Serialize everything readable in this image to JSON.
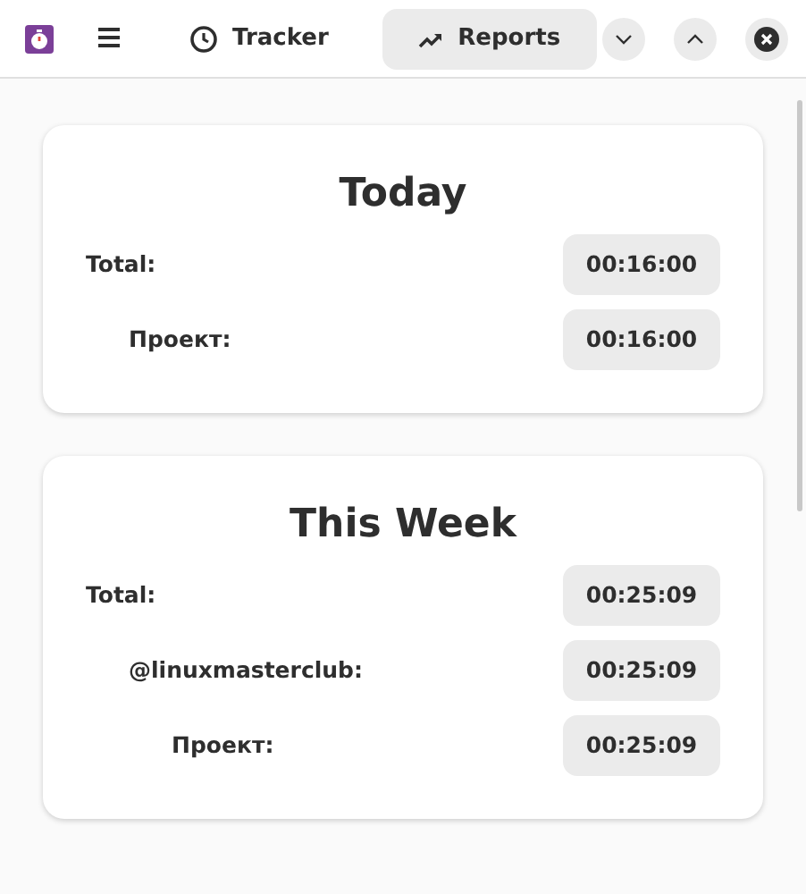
{
  "header": {
    "tabs": [
      {
        "label": "Tracker",
        "selected": false
      },
      {
        "label": "Reports",
        "selected": true
      }
    ]
  },
  "reports": [
    {
      "title": "Today",
      "rows": [
        {
          "label": "Total:",
          "time": "00:16:00",
          "children": [
            {
              "label": "Проект:",
              "time": "00:16:00"
            }
          ]
        }
      ]
    },
    {
      "title": "This Week",
      "rows": [
        {
          "label": "Total:",
          "time": "00:25:09",
          "children": [
            {
              "label": "@linuxmasterclub:",
              "time": "00:25:09",
              "children": [
                {
                  "label": "Проект:",
                  "time": "00:25:09"
                }
              ]
            }
          ]
        }
      ]
    }
  ]
}
